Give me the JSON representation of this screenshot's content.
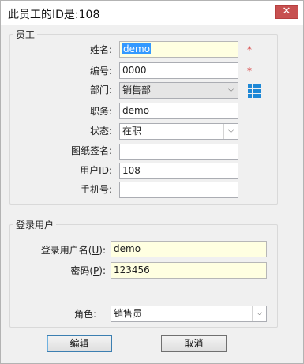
{
  "window": {
    "title": "此员工的ID是:108",
    "close_glyph": "✕"
  },
  "employee_group": {
    "legend": "员工",
    "name": {
      "label": "姓名:",
      "value": "demo",
      "required_mark": "*"
    },
    "number": {
      "label": "编号:",
      "value": "0000",
      "required_mark": "*"
    },
    "department": {
      "label": "部门:",
      "value": "销售部",
      "picker_icon": "grid-icon"
    },
    "position": {
      "label": "职务:",
      "value": "demo"
    },
    "status": {
      "label": "状态:",
      "value": "在职"
    },
    "signature": {
      "label": "图纸签名:",
      "value": ""
    },
    "user_id": {
      "label": "用户ID:",
      "value": "108"
    },
    "phone": {
      "label": "手机号:",
      "value": ""
    }
  },
  "login_group": {
    "legend": "登录用户",
    "username": {
      "label_pre": "登录用户名(",
      "label_key": "U",
      "label_post": "):",
      "value": "demo"
    },
    "password": {
      "label_pre": "密码(",
      "label_key": "P",
      "label_post": "):",
      "value": "123456"
    },
    "role": {
      "label": "角色:",
      "value": "销售员"
    }
  },
  "buttons": {
    "edit": "编辑",
    "cancel": "取消"
  },
  "colors": {
    "required": "#d84040",
    "highlight_field": "#ffffe1",
    "selection": "#3399ff",
    "icon": "#1e88d6"
  }
}
